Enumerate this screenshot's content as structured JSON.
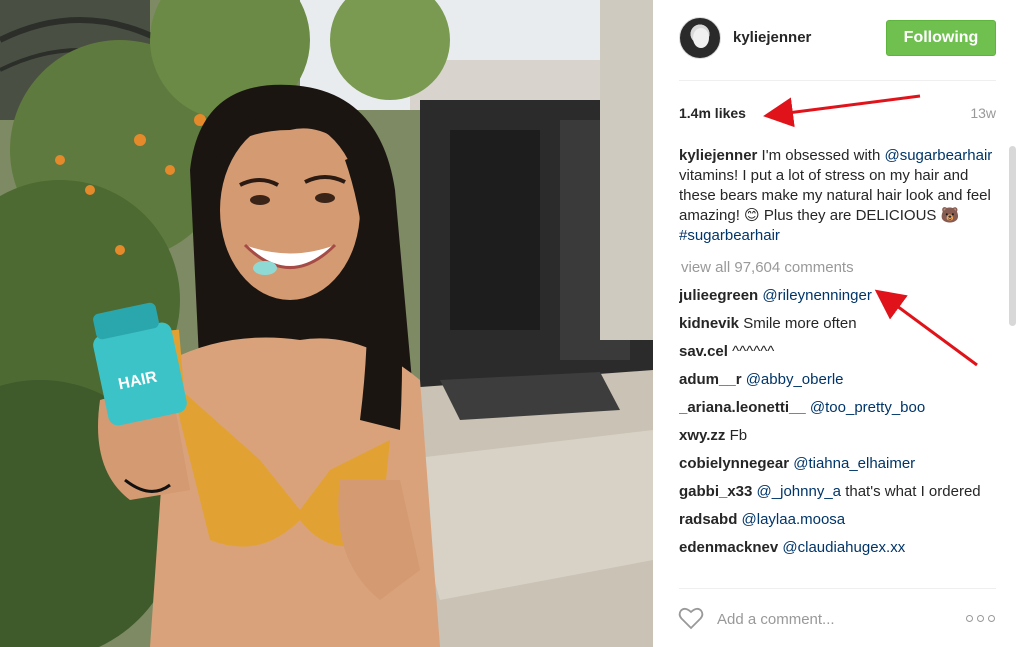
{
  "post": {
    "image_alt": "",
    "username": "kyliejenner",
    "follow_label": "Following",
    "likes": "1.4m likes",
    "age": "13w",
    "caption": {
      "user": "kyliejenner",
      "text_1": " I'm obsessed with ",
      "mention": "@sugarbearhair",
      "text_2": " vitamins! I put a lot of stress on my hair and these bears make my natural hair look and feel amazing! ",
      "emoji_1": "😊",
      "text_3": " Plus they are DELICIOUS ",
      "emoji_2": "🐻",
      "hashtag": "#sugarbearhair"
    },
    "view_all": "view all 97,604 comments",
    "comments": [
      {
        "user": "julieegreen",
        "mention": "@rileynenninger",
        "text": ""
      },
      {
        "user": "kidnevik",
        "mention": "",
        "text": "Smile more often"
      },
      {
        "user": "sav.cel",
        "mention": "",
        "text": "^^^^^^"
      },
      {
        "user": "adum__r",
        "mention": "@abby_oberle",
        "text": ""
      },
      {
        "user": "_ariana.leonetti__",
        "mention": "@too_pretty_boo",
        "text": ""
      },
      {
        "user": "xwy.zz",
        "mention": "",
        "text": "Fb"
      },
      {
        "user": "cobielynnegear",
        "mention": "@tiahna_elhaimer",
        "text": ""
      },
      {
        "user": "gabbi_x33",
        "mention": "@_johnny_a",
        "text": "that's what I ordered"
      },
      {
        "user": "radsabd",
        "mention": "@laylaa.moosa",
        "text": ""
      },
      {
        "user": "edenmacknev",
        "mention": "@claudiahugex.xx",
        "text": ""
      }
    ],
    "add_comment_placeholder": "Add a comment...",
    "icons": {
      "like": "heart-icon",
      "more": "more-options-icon",
      "annotation": "red-arrow-icon"
    },
    "colors": {
      "follow": "#70c050",
      "link": "#003569",
      "arrow": "#e0131a"
    }
  }
}
